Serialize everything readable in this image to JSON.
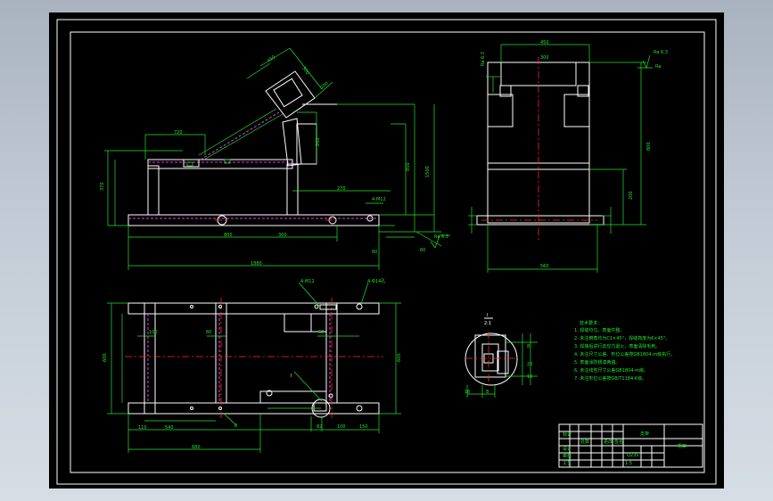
{
  "window": {
    "background_top": "#a9b3bf",
    "background_bottom": "#d6dde5"
  },
  "drawing": {
    "colors": {
      "background": "#000000",
      "outline": "#ffffff",
      "dimension": "#25e32c",
      "hidden_line": "#e13de7",
      "center_line": "#ff2a2a"
    },
    "roughness_symbol": "Ra 6.3",
    "detail_label": "I",
    "title_block_text": "ce"
  }
}
